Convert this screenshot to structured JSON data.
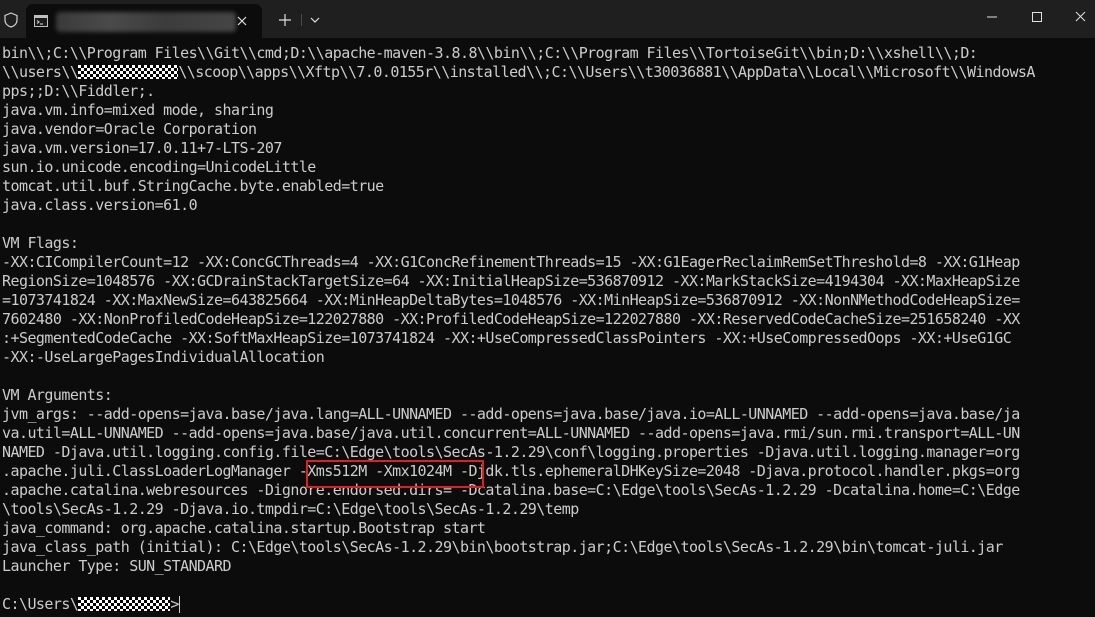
{
  "window": {
    "tab_title": "",
    "icons": {
      "shield": "shield-icon",
      "tab": "terminal-icon",
      "tab_close": "close-icon",
      "new_tab": "plus-icon",
      "dropdown": "chevron-down-icon",
      "minimize": "minimize-icon",
      "maximize": "maximize-icon",
      "close": "close-icon"
    },
    "colors": {
      "background": "#0c0c0c",
      "titlebar": "#1f1f1f",
      "text": "#cccccc",
      "highlight_border": "#e0201e"
    }
  },
  "terminal": {
    "lines": [
      "bin\\\\;C:\\\\Program Files\\\\Git\\\\cmd;D:\\\\apache-maven-3.8.8\\\\bin\\\\;C:\\\\Program Files\\\\TortoiseGit\\\\bin;D:\\\\xshell\\\\;D:",
      "\\\\users\\\\",
      "\\\\scoop\\\\apps\\\\Xftp\\\\7.0.0155r\\\\installed\\\\;C:\\\\Users\\\\t30036881\\\\AppData\\\\Local\\\\Microsoft\\\\WindowsA",
      "pps;;D:\\\\Fiddler;.",
      "java.vm.info=mixed mode, sharing",
      "java.vendor=Oracle Corporation",
      "java.vm.version=17.0.11+7-LTS-207",
      "sun.io.unicode.encoding=UnicodeLittle",
      "tomcat.util.buf.StringCache.byte.enabled=true",
      "java.class.version=61.0",
      "VM Flags:",
      "-XX:CICompilerCount=12 -XX:ConcGCThreads=4 -XX:G1ConcRefinementThreads=15 -XX:G1EagerReclaimRemSetThreshold=8 -XX:G1Heap",
      "RegionSize=1048576 -XX:GCDrainStackTargetSize=64 -XX:InitialHeapSize=536870912 -XX:MarkStackSize=4194304 -XX:MaxHeapSize",
      "=1073741824 -XX:MaxNewSize=643825664 -XX:MinHeapDeltaBytes=1048576 -XX:MinHeapSize=536870912 -XX:NonNMethodCodeHeapSize=",
      "7602480 -XX:NonProfiledCodeHeapSize=122027880 -XX:ProfiledCodeHeapSize=122027880 -XX:ReservedCodeCacheSize=251658240 -XX",
      ":+SegmentedCodeCache -XX:SoftMaxHeapSize=1073741824 -XX:+UseCompressedClassPointers -XX:+UseCompressedOops -XX:+UseG1GC",
      "-XX:-UseLargePagesIndividualAllocation",
      "VM Arguments:",
      "jvm_args: --add-opens=java.base/java.lang=ALL-UNNAMED --add-opens=java.base/java.io=ALL-UNNAMED --add-opens=java.base/ja",
      "va.util=ALL-UNNAMED --add-opens=java.base/java.util.concurrent=ALL-UNNAMED --add-opens=java.rmi/sun.rmi.transport=ALL-UN",
      "NAMED -Djava.util.logging.config.file=C:\\Edge\\tools\\SecAs-1.2.29\\conf\\logging.properties -Djava.util.logging.manager=org",
      ".apache.juli.ClassLoaderLogManager -Xms512M -Xmx1024M -Djdk.tls.ephemeralDHKeySize=2048 -Djava.protocol.handler.pkgs=org",
      ".apache.catalina.webresources -Dignore.endorsed.dirs= -Dcatalina.base=C:\\Edge\\tools\\SecAs-1.2.29 -Dcatalina.home=C:\\Edge",
      "\\tools\\SecAs-1.2.29 -Djava.io.tmpdir=C:\\Edge\\tools\\SecAs-1.2.29\\temp",
      "java_command: org.apache.catalina.startup.Bootstrap start",
      "java_class_path (initial): C:\\Edge\\tools\\SecAs-1.2.29\\bin\\bootstrap.jar;C:\\Edge\\tools\\SecAs-1.2.29\\bin\\tomcat-juli.jar",
      "Launcher Type: SUN_STANDARD",
      "C:\\Users\\",
      ">"
    ],
    "highlighted_text": "-Xms512M -Xmx1024M"
  }
}
